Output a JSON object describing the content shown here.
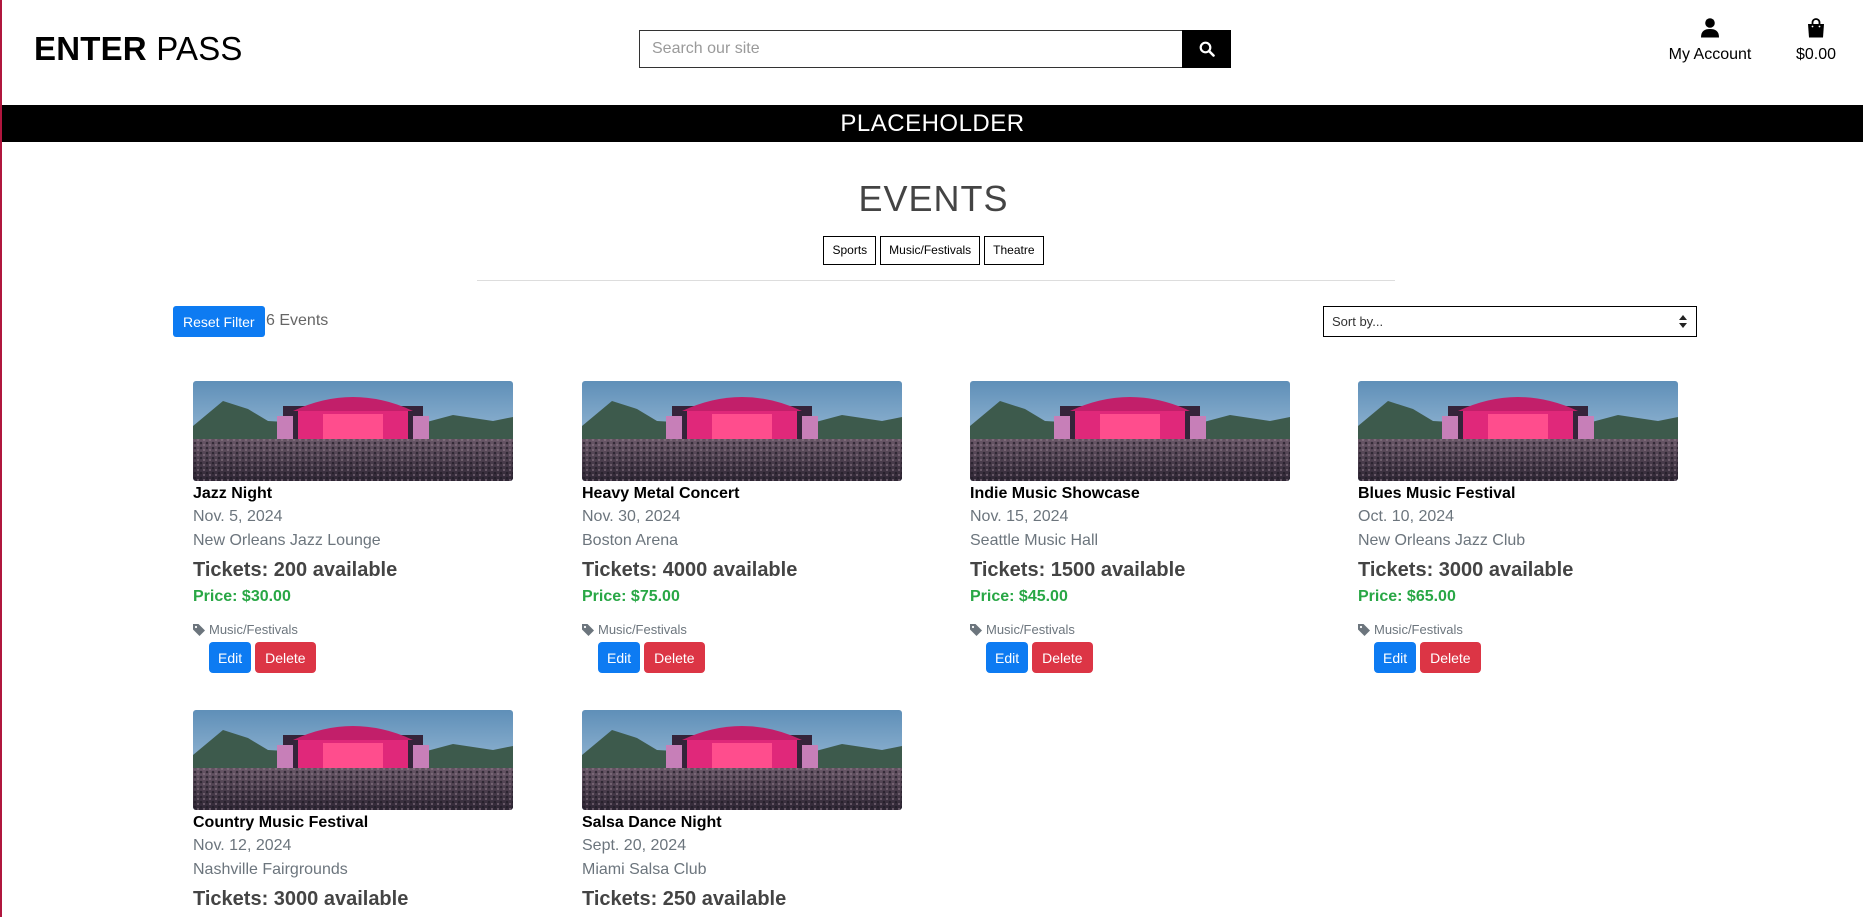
{
  "header": {
    "logo_bold": "ENTER",
    "logo_light": "PASS",
    "search_placeholder": "Search our site",
    "account_label": "My Account",
    "cart_total": "$0.00"
  },
  "banner": {
    "text": "PLACEHOLDER"
  },
  "page": {
    "title": "EVENTS",
    "categories": [
      "Sports",
      "Music/Festivals",
      "Theatre"
    ],
    "reset_label": "Reset Filter",
    "event_count": "6 Events",
    "sort_placeholder": "Sort by..."
  },
  "events": [
    {
      "name": "Jazz Night",
      "date": "Nov. 5, 2024",
      "venue": "New Orleans Jazz Lounge",
      "tickets": "Tickets: 200 available",
      "price": "Price: $30.00",
      "category": "Music/Festivals",
      "edit": "Edit",
      "delete": "Delete"
    },
    {
      "name": "Heavy Metal Concert",
      "date": "Nov. 30, 2024",
      "venue": "Boston Arena",
      "tickets": "Tickets: 4000 available",
      "price": "Price: $75.00",
      "category": "Music/Festivals",
      "edit": "Edit",
      "delete": "Delete"
    },
    {
      "name": "Indie Music Showcase",
      "date": "Nov. 15, 2024",
      "venue": "Seattle Music Hall",
      "tickets": "Tickets: 1500 available",
      "price": "Price: $45.00",
      "category": "Music/Festivals",
      "edit": "Edit",
      "delete": "Delete"
    },
    {
      "name": "Blues Music Festival",
      "date": "Oct. 10, 2024",
      "venue": "New Orleans Jazz Club",
      "tickets": "Tickets: 3000 available",
      "price": "Price: $65.00",
      "category": "Music/Festivals",
      "edit": "Edit",
      "delete": "Delete"
    },
    {
      "name": "Country Music Festival",
      "date": "Nov. 12, 2024",
      "venue": "Nashville Fairgrounds",
      "tickets": "Tickets: 3000 available",
      "price": "",
      "category": "",
      "edit": "",
      "delete": ""
    },
    {
      "name": "Salsa Dance Night",
      "date": "Sept. 20, 2024",
      "venue": "Miami Salsa Club",
      "tickets": "Tickets: 250 available",
      "price": "",
      "category": "",
      "edit": "",
      "delete": ""
    }
  ],
  "colors": {
    "primary": "#0d7bf2",
    "danger": "#dc3545",
    "price": "#28a745",
    "banner": "#000000"
  },
  "icons": {
    "search": "search-icon",
    "account": "user-icon",
    "cart": "shopping-bag-icon",
    "tag": "tag-icon",
    "sort": "sort-icon"
  }
}
